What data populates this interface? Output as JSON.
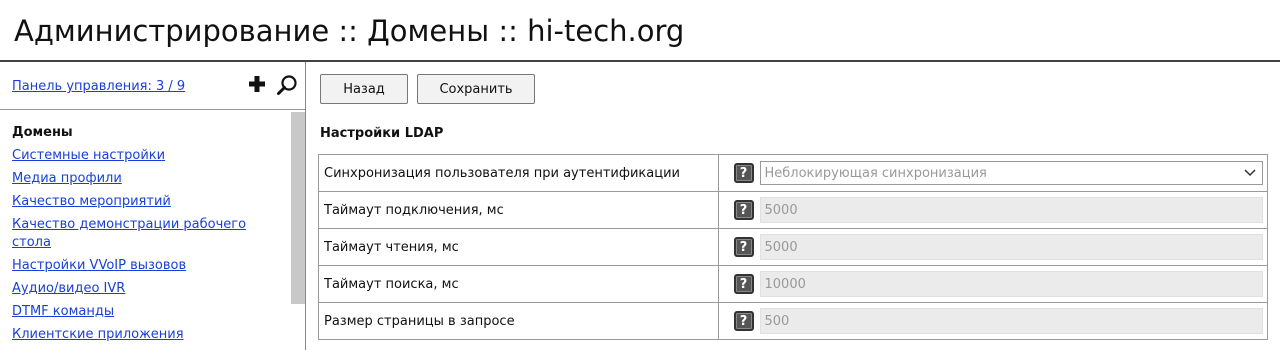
{
  "header": {
    "title": "Администрирование :: Домены :: hi-tech.org"
  },
  "sidebar": {
    "panel_link": "Панель управления: 3 / 9",
    "items": [
      {
        "label": "Домены",
        "active": true
      },
      {
        "label": "Системные настройки"
      },
      {
        "label": "Медиа профили"
      },
      {
        "label": "Качество мероприятий"
      },
      {
        "label": "Качество демонстрации рабочего стола"
      },
      {
        "label": "Настройки VVoIP вызовов"
      },
      {
        "label": "Аудио/видео IVR"
      },
      {
        "label": "DTMF команды"
      },
      {
        "label": "Клиентские приложения"
      }
    ]
  },
  "toolbar": {
    "back_label": "Назад",
    "save_label": "Сохранить"
  },
  "section": {
    "title": "Настройки LDAP"
  },
  "settings": [
    {
      "label": "Синхронизация пользователя при аутентификации",
      "value": "Неблокирующая синхронизация",
      "type": "select"
    },
    {
      "label": "Таймаут подключения, мс",
      "value": "5000",
      "type": "input"
    },
    {
      "label": "Таймаут чтения, мс",
      "value": "5000",
      "type": "input"
    },
    {
      "label": "Таймаут поиска, мс",
      "value": "10000",
      "type": "input"
    },
    {
      "label": "Размер страницы в запросе",
      "value": "500",
      "type": "input"
    }
  ],
  "help_glyph": "?",
  "icons": {
    "add": "plus-icon",
    "search": "search-icon",
    "help": "help-icon",
    "dropdown": "chevron-down-icon"
  },
  "colors": {
    "link": "#1a3fd6",
    "field_bg": "#ebebeb",
    "help_bg": "#555555"
  }
}
